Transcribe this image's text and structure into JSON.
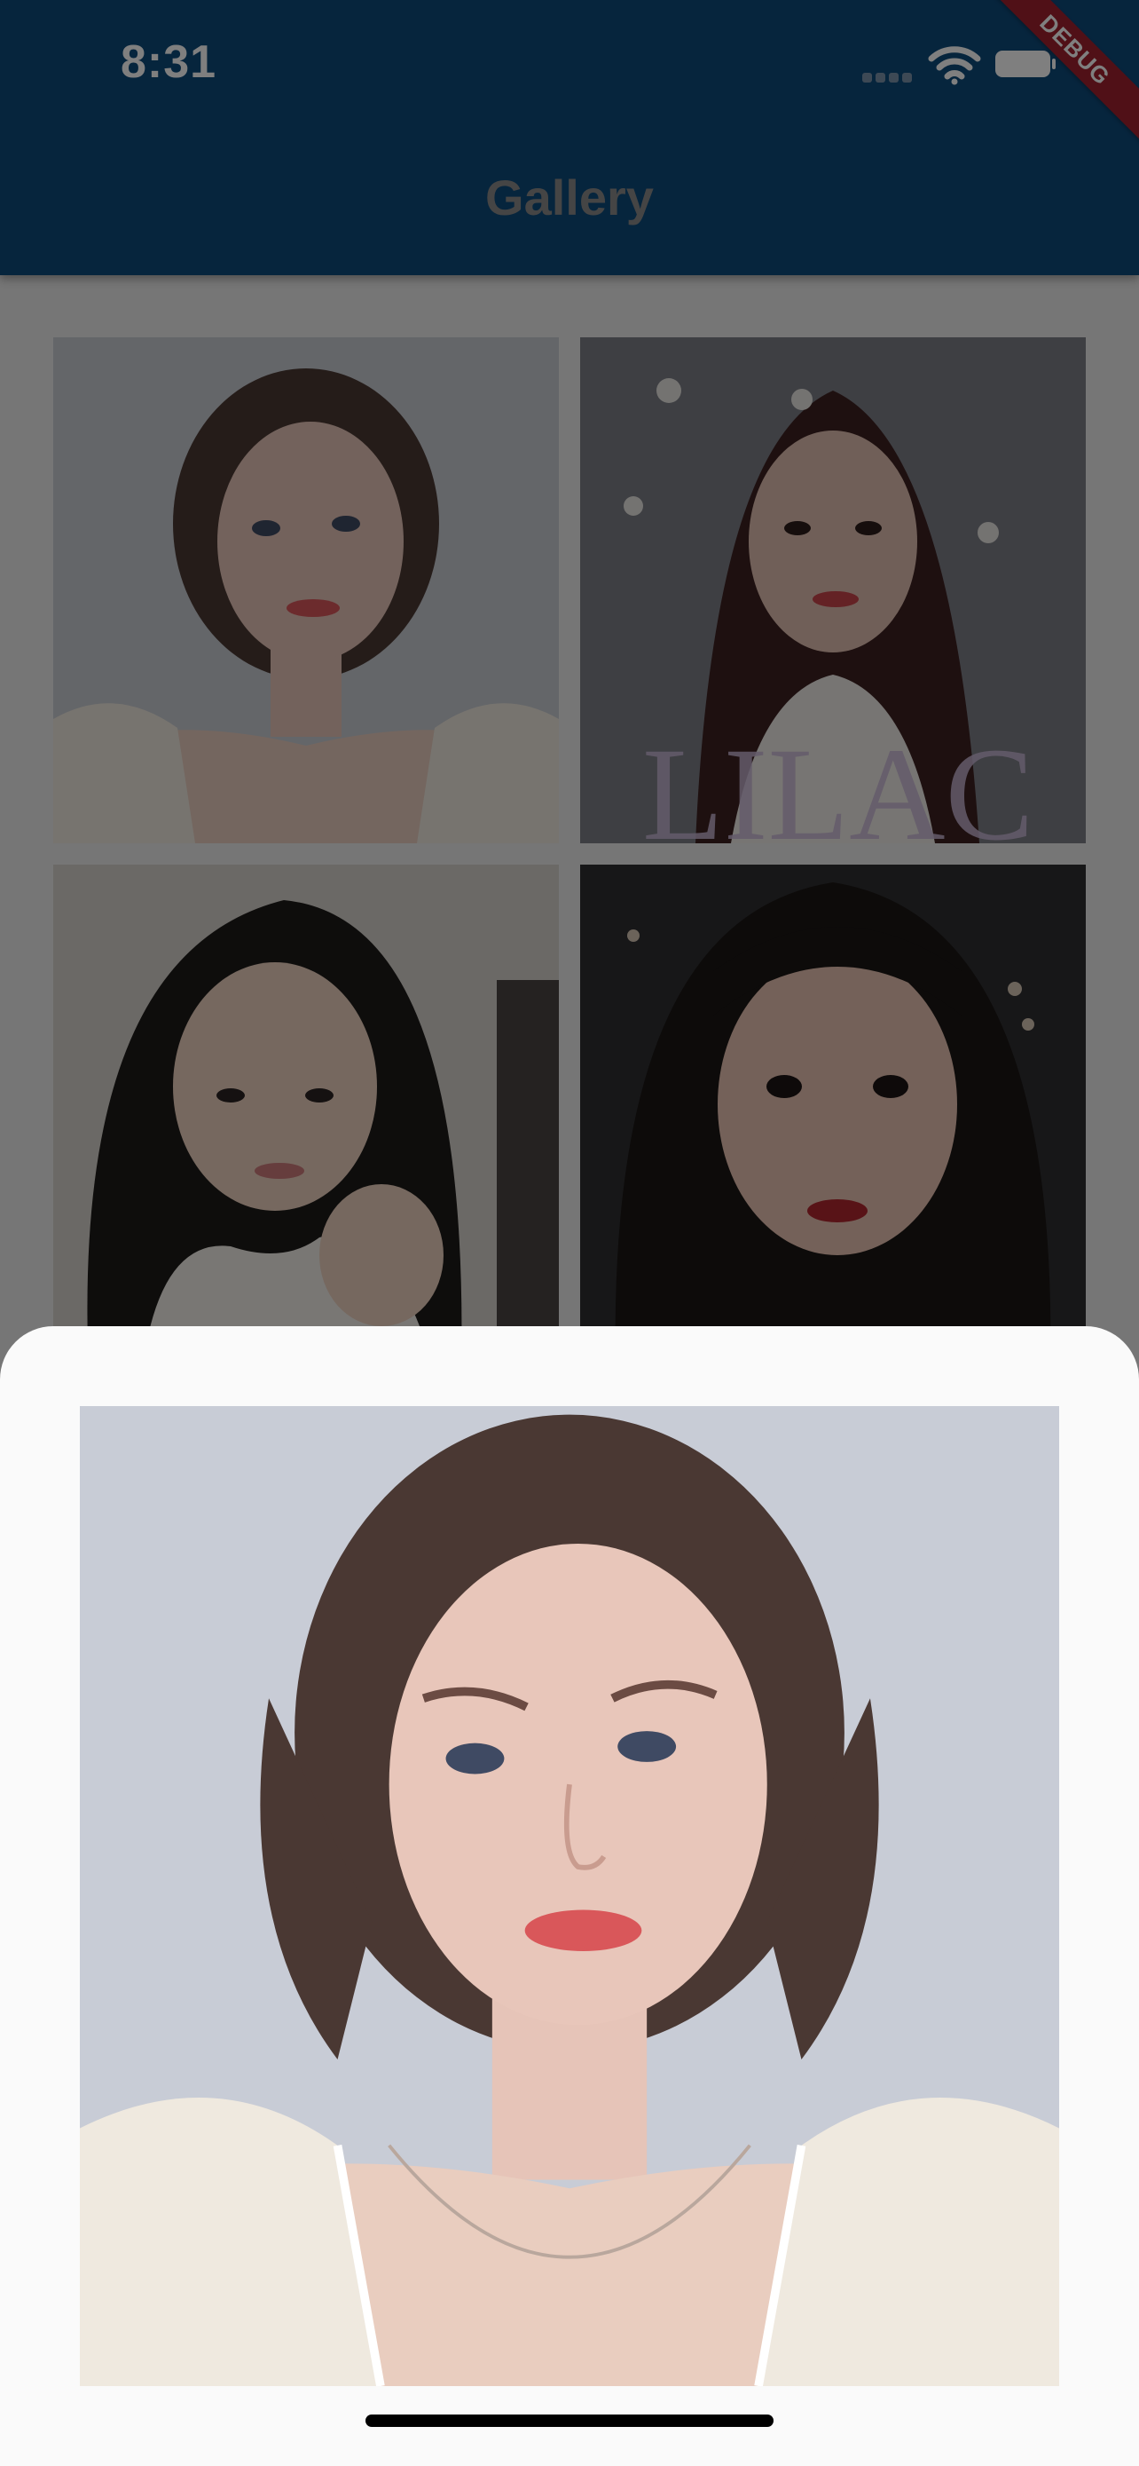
{
  "status_bar": {
    "time": "8:31",
    "debug_banner": "DEBUG"
  },
  "app_bar": {
    "title": "Gallery"
  },
  "gallery": {
    "thumbnails": [
      {
        "name": "photo-1",
        "background": "#c9ccd3",
        "hair": "#4a3833",
        "skin": "#e6c4b8",
        "clothing": "#efe9df"
      },
      {
        "name": "photo-2",
        "background": "#7d7f87",
        "hair": "#3c2020",
        "skin": "#e0bfb0",
        "clothing": "#eeeae6",
        "overlay_text": "LILAC"
      },
      {
        "name": "photo-3",
        "background": "#d6d2cc",
        "hair": "#1d1a19",
        "skin": "#ecd0bf",
        "clothing": "#f2eee8"
      },
      {
        "name": "photo-4",
        "background": "#2e2e30",
        "hair": "#1a1614",
        "skin": "#e9c3b2",
        "clothing": "#2a2220"
      }
    ]
  },
  "bottom_sheet": {
    "selected_photo": "photo-1",
    "background": "#c8ccd6"
  },
  "colors": {
    "app_bar": "#0d4a7b",
    "debug_ribbon": "#a0212f",
    "sheet": "#fafafa"
  }
}
